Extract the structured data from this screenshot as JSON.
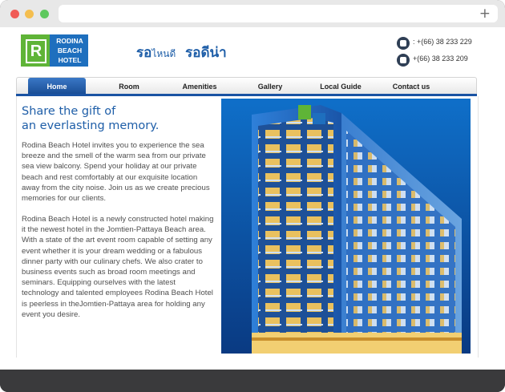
{
  "browser": {
    "new_tab_label": "+"
  },
  "logo": {
    "letter": "R",
    "lines": [
      "RODINA",
      "BEACH",
      "HOTEL"
    ]
  },
  "tagline": {
    "part1": "รอ",
    "part2": "ไหนดี",
    "part3": "รอดีน่า"
  },
  "contact": {
    "phone": ": +(66) 38 233 229",
    "fax": "+(66) 38 233 209",
    "phone_icon": "phone-icon",
    "fax_icon": "fax-icon"
  },
  "nav": {
    "items": [
      {
        "label": "Home",
        "active": true
      },
      {
        "label": "Room"
      },
      {
        "label": "Amenities"
      },
      {
        "label": "Gallery"
      },
      {
        "label": "Local Guide"
      },
      {
        "label": "Contact us"
      }
    ]
  },
  "main": {
    "heading_line1": "Share the gift of",
    "heading_line2": "an everlasting memory.",
    "paragraph1": "Rodina Beach Hotel invites you to experience the sea breeze and the smell of the warm sea from our private sea view balcony. Spend your holiday at our private beach and rest comfortably at our exquisite location away from the city noise. Join us as we create precious memories for our clients.",
    "paragraph2": "Rodina Beach Hotel is a newly constructed hotel making it the newest hotel in the Jomtien-Pattaya Beach area. With a state of the art event room capable of setting any event whether it is your dream wedding or a fabulous dinner party with our culinary chefs. We also crater to business events such as broad room meetings and seminars. Equipping ourselves with the latest technology and talented employees Rodina Beach Hotel is peerless in theJomtien-Pattaya area for holding any event you desire."
  },
  "colors": {
    "brand_blue": "#1e5ea8",
    "logo_green": "#5fb437",
    "nav_active": "#1a53a3"
  }
}
